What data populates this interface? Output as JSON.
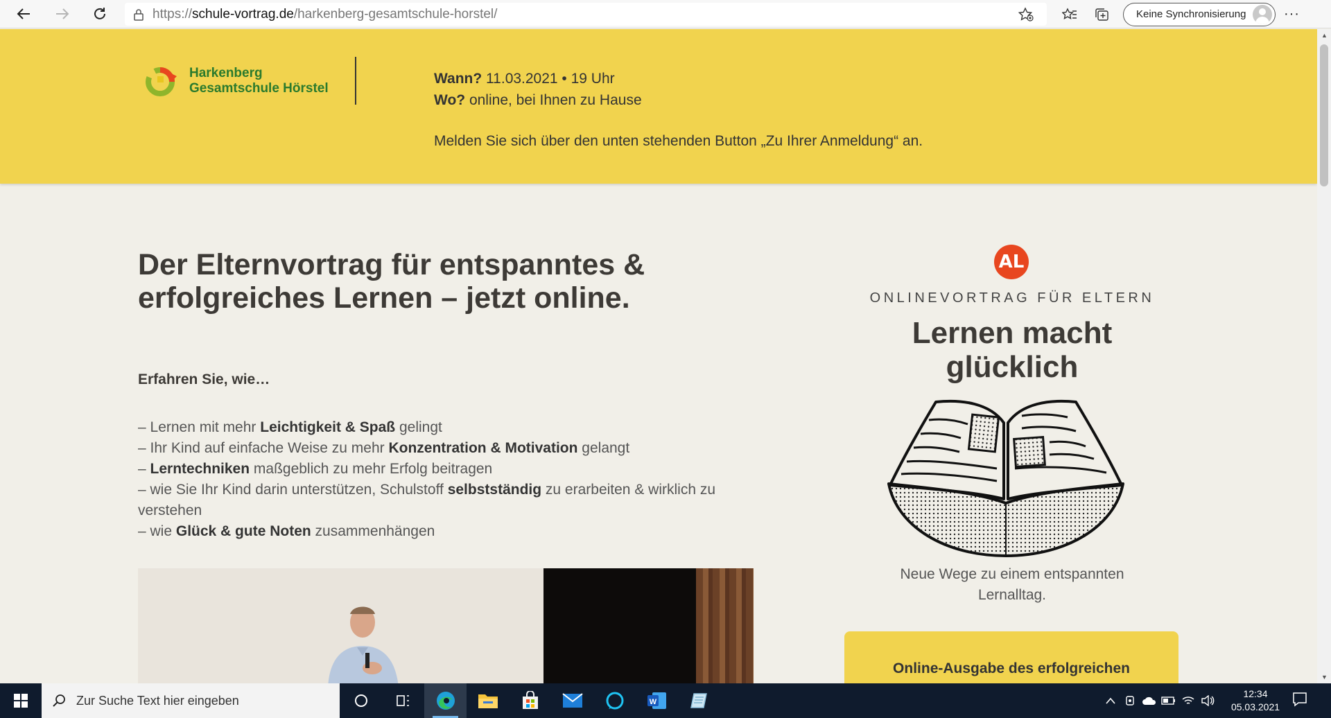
{
  "browser": {
    "url_prefix": "https://",
    "url_host": "schule-vortrag.de",
    "url_path": "/harkenberg-gesamtschule-horstel/",
    "sync_label": "Keine Synchronisierung"
  },
  "header": {
    "school_name_line1": "Harkenberg",
    "school_name_line2": "Gesamtschule Hörstel",
    "when_label": "Wann?",
    "when_value": " 11.03.2021 • 19 Uhr",
    "where_label": "Wo?",
    "where_value": " online, bei Ihnen zu Hause",
    "register_text": "Melden Sie sich über den unten stehenden Button „Zu Ihrer Anmeldung“ an."
  },
  "main": {
    "headline_line1": "Der Elternvortrag für entspanntes &",
    "headline_line2": "erfolgreiches Lernen – jetzt online.",
    "intro": "Erfahren Sie, wie…",
    "bullets": [
      {
        "pre": "– Lernen mit mehr ",
        "bold": "Leichtigkeit & Spaß",
        "post": " gelingt"
      },
      {
        "pre": "– Ihr Kind auf einfache Weise zu mehr ",
        "bold": "Konzentration & Motivation",
        "post": " gelangt"
      },
      {
        "pre": "– ",
        "bold": "Lerntechniken",
        "post": " maßgeblich zu mehr Erfolg beitragen"
      },
      {
        "pre": "– wie Sie Ihr Kind darin unterstützen, Schulstoff ",
        "bold": "selbstständig",
        "post": " zu erarbeiten & wirklich zu verstehen"
      },
      {
        "pre": "– wie ",
        "bold": "Glück & gute Noten",
        "post": " zusammenhängen"
      }
    ]
  },
  "aside": {
    "logo_letters": "AL",
    "kicker": "ONLINEVORTRAG FÜR ELTERN",
    "title_line1": "Lernen macht",
    "title_line2": "glücklich",
    "tagline_line1": "Neue Wege zu einem entspannten",
    "tagline_line2": "Lernalltag.",
    "cta_text": "Online-Ausgabe des erfolgreichen"
  },
  "taskbar": {
    "search_placeholder": "Zur Suche Text hier eingeben",
    "time": "12:34",
    "date": "05.03.2021",
    "word_letter": "W"
  },
  "colors": {
    "header_yellow": "#f1d34e",
    "page_bg": "#f1efe8",
    "brand_orange": "#e8461f",
    "school_green": "#2a7a2d"
  }
}
